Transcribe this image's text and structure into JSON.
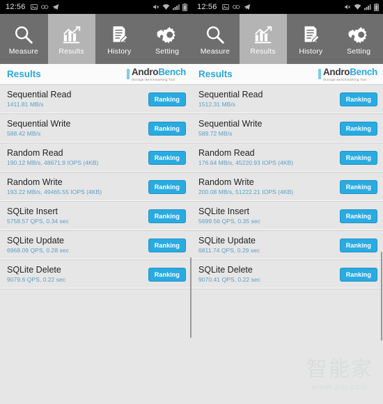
{
  "status_bar": {
    "time": "12:56",
    "left_icons": [
      "image-icon",
      "link-icon",
      "telegram-icon"
    ],
    "right_icons": [
      "mute-icon",
      "wifi-icon",
      "signal-icon",
      "battery-icon"
    ]
  },
  "tabs": [
    {
      "label": "Measure",
      "icon": "magnifier-icon",
      "active": false
    },
    {
      "label": "Results",
      "icon": "bar-chart-icon",
      "active": true
    },
    {
      "label": "History",
      "icon": "document-icon",
      "active": false
    },
    {
      "label": "Setting",
      "icon": "gears-icon",
      "active": false
    }
  ],
  "title_bar": {
    "title": "Results",
    "brand_name_part1": "Andro",
    "brand_name_part2": "Bench",
    "brand_tagline": "Storage Benchmarking Tool"
  },
  "ranking_label": "Ranking",
  "left_panel": {
    "rows": [
      {
        "name": "Sequential Read",
        "value": "1411.81 MB/s"
      },
      {
        "name": "Sequential Write",
        "value": "588.42 MB/s"
      },
      {
        "name": "Random Read",
        "value": "190.12 MB/s, 48671.9 IOPS (4KB)"
      },
      {
        "name": "Random Write",
        "value": "193.22 MB/s, 49465.55 IOPS (4KB)"
      },
      {
        "name": "SQLite Insert",
        "value": "5758.57 QPS, 0.34 sec"
      },
      {
        "name": "SQLite Update",
        "value": "6968.09 QPS, 0.28 sec"
      },
      {
        "name": "SQLite Delete",
        "value": "9079.6 QPS, 0.22 sec"
      }
    ]
  },
  "right_panel": {
    "rows": [
      {
        "name": "Sequential Read",
        "value": "1512.31 MB/s"
      },
      {
        "name": "Sequential Write",
        "value": "589.72 MB/s"
      },
      {
        "name": "Random Read",
        "value": "176.64 MB/s, 45220.93 IOPS (4KB)"
      },
      {
        "name": "Random Write",
        "value": "200.08 MB/s, 51222.21 IOPS (4KB)"
      },
      {
        "name": "SQLite Insert",
        "value": "5699.56 QPS, 0.35 sec"
      },
      {
        "name": "SQLite Update",
        "value": "6811.74 QPS, 0.29 sec"
      },
      {
        "name": "SQLite Delete",
        "value": "9070.41 QPS, 0.22 sec"
      }
    ]
  },
  "watermark": {
    "text_cn": "智能家",
    "url": "www.znj.com"
  },
  "colors": {
    "accent_blue": "#29abe2",
    "title_blue": "#29a8df",
    "value_blue": "#5b9fc4",
    "tab_bar_gray": "#6e6e6e",
    "tab_active_gray": "#b4b4b4",
    "list_bg": "#e6e6e6"
  }
}
